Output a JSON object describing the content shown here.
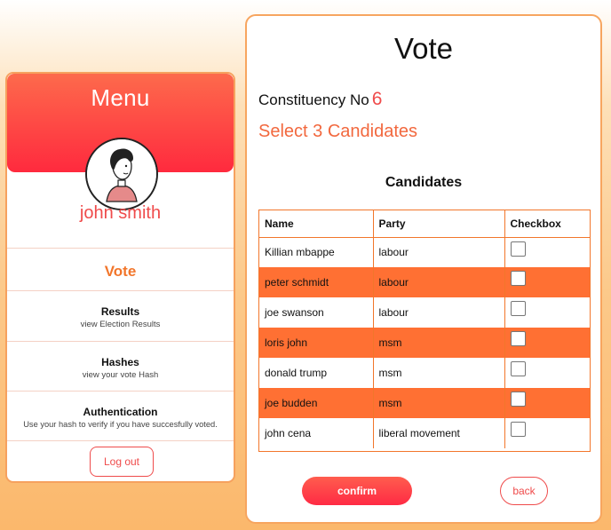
{
  "menu": {
    "title": "Menu",
    "user_name": "john smith",
    "items": [
      {
        "label": "Vote",
        "sub": ""
      },
      {
        "label": "Results",
        "sub": "view Election Results"
      },
      {
        "label": "Hashes",
        "sub": "view your vote Hash"
      },
      {
        "label": "Authentication",
        "sub": "Use your hash to verify if you have succesfully voted."
      }
    ],
    "logout_label": "Log out"
  },
  "vote": {
    "title": "Vote",
    "constituency_label": "Constituency No",
    "constituency_number": "6",
    "instruction": "Select 3 Candidates",
    "table_heading": "Candidates",
    "columns": [
      "Name",
      "Party",
      "Checkbox"
    ],
    "candidates": [
      {
        "name": "Killian mbappe",
        "party": "labour",
        "checked": false
      },
      {
        "name": "peter schmidt",
        "party": "labour",
        "checked": false
      },
      {
        "name": "joe swanson",
        "party": "labour",
        "checked": false
      },
      {
        "name": "loris john",
        "party": "msm",
        "checked": false
      },
      {
        "name": "donald trump",
        "party": "msm",
        "checked": false
      },
      {
        "name": "joe budden",
        "party": "msm",
        "checked": false
      },
      {
        "name": "john cena",
        "party": "liberal movement",
        "checked": false
      }
    ],
    "confirm_label": "confirm",
    "back_label": "back"
  },
  "colors": {
    "accent": "#ef4b4b",
    "orange": "#f2762b",
    "row_highlight": "#ff7033",
    "header_gradient_top": "#fd6a4c",
    "header_gradient_bottom": "#ff2a3e"
  },
  "icons": {
    "avatar": "user-avatar-icon"
  }
}
